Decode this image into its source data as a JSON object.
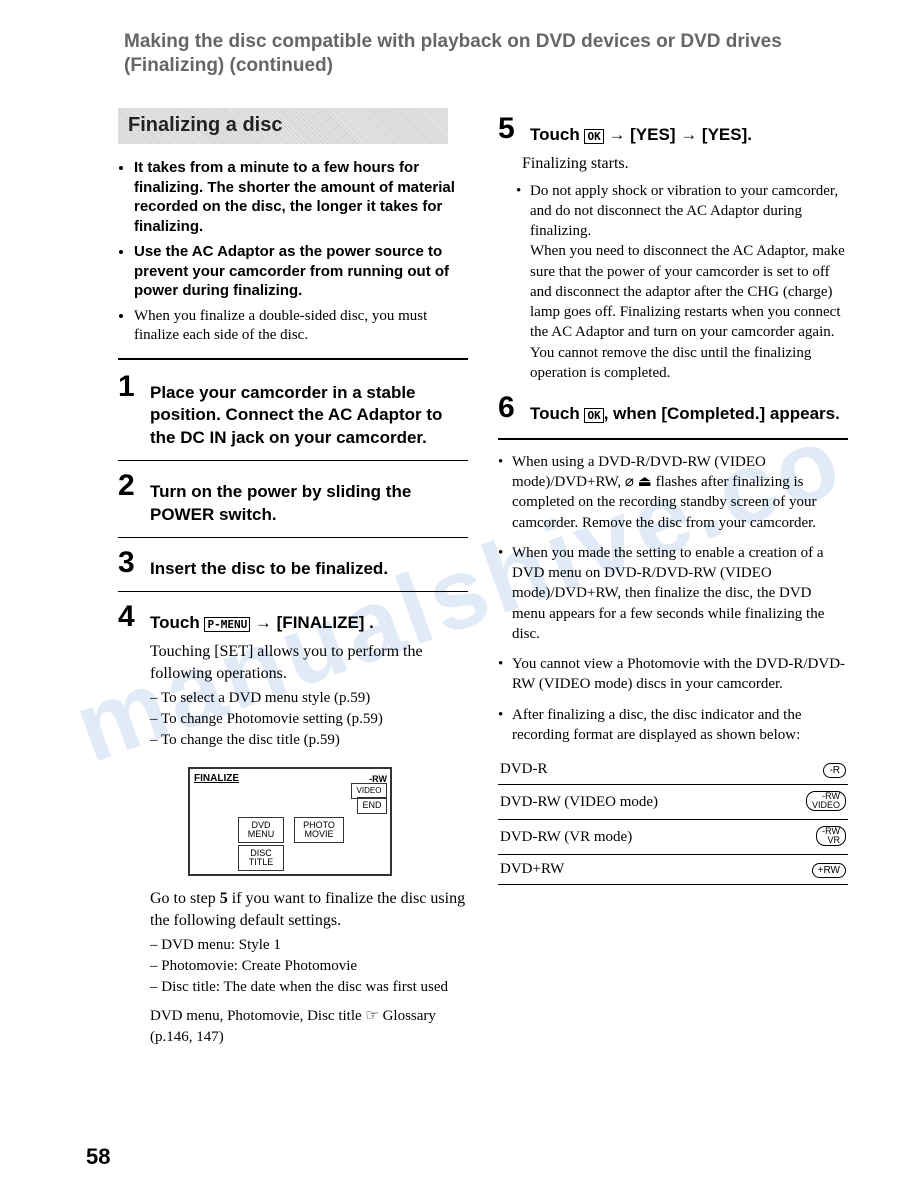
{
  "watermark_text": "manualshive.co",
  "page_title": "Making the disc compatible with playback on DVD devices or DVD drives (Finalizing) (continued)",
  "section_heading": "Finalizing a disc",
  "intro_bullets": [
    "It takes from a minute to a few hours for finalizing. The shorter the amount of material recorded on the disc, the longer it takes for finalizing.",
    "Use the AC Adaptor as the power source to prevent your camcorder from running out of power during finalizing."
  ],
  "intro_note": "When you finalize a double-sided disc, you must finalize each side of the disc.",
  "step1_num": "1",
  "step1_text": "Place your camcorder in a stable position. Connect the AC Adaptor to the DC IN jack on your camcorder.",
  "step2_num": "2",
  "step2_text": "Turn on the power by sliding the POWER switch.",
  "step3_num": "3",
  "step3_text": "Insert the disc to be finalized.",
  "step4_num": "4",
  "step4_prefix": "Touch ",
  "step4_button": "P-MENU",
  "step4_suffix": " → [FINALIZE] .",
  "step4_after": "Touching [SET] allows you to perform the following operations.",
  "step4_dashes": [
    "To select a DVD menu style (p.59)",
    "To change Photomovie setting (p.59)",
    "To change the disc title (p.59)"
  ],
  "screen": {
    "label": "FINALIZE",
    "tag_rw": "-RW",
    "tag_video": "VIDEO",
    "btn_end": "END",
    "btn_dvd_menu": "DVD\nMENU",
    "btn_photo_movie": "PHOTO\nMOVIE",
    "btn_disc_title": "DISC\nTITLE"
  },
  "step4_goto_a": "Go to step ",
  "step4_goto_b": "5",
  "step4_goto_c": " if you want to finalize the disc using the following default settings.",
  "step4_defaults": [
    "DVD menu: Style 1",
    "Photomovie: Create Photomovie",
    "Disc title: The date when the disc was first used"
  ],
  "glossary_note": "DVD menu, Photomovie, Disc title ☞ Glossary (p.146, 147)",
  "step5_num": "5",
  "step5_prefix": "Touch ",
  "step5_btn": "OK",
  "step5_suffix": " → [YES] → [YES].",
  "step5_after": "Finalizing starts.",
  "step5_bullet": "Do not apply shock or vibration to your camcorder, and do not disconnect the AC Adaptor during finalizing.\nWhen you need to disconnect the AC Adaptor, make sure that the power of your camcorder is set to off and disconnect the adaptor after the CHG (charge) lamp goes off. Finalizing restarts when you connect the AC Adaptor and turn on your camcorder again. You cannot remove the disc until the finalizing operation is completed.",
  "step6_num": "6",
  "step6_prefix": "Touch ",
  "step6_btn": "OK",
  "step6_suffix": ", when [Completed.] appears.",
  "post_bullets": [
    "When using a DVD-R/DVD-RW (VIDEO mode)/DVD+RW, ⌀ ⏏ flashes after finalizing is completed on the recording standby screen of your camcorder. Remove the disc from your camcorder.",
    "When you made the setting to enable a creation of a DVD menu on DVD-R/DVD-RW (VIDEO mode)/DVD+RW, then finalize the disc, the DVD menu appears for a few seconds while finalizing the disc.",
    "You cannot view a Photomovie with the DVD-R/DVD-RW (VIDEO mode) discs in your camcorder.",
    "After finalizing a disc, the disc indicator and the recording format are displayed as shown below:"
  ],
  "indicator_table": [
    {
      "label": "DVD-R",
      "icon": "-R"
    },
    {
      "label": "DVD-RW (VIDEO mode)",
      "icon": "-RW\nVIDEO"
    },
    {
      "label": "DVD-RW (VR mode)",
      "icon": "-RW\nVR"
    },
    {
      "label": "DVD+RW",
      "icon": "+RW"
    }
  ],
  "page_number": "58"
}
